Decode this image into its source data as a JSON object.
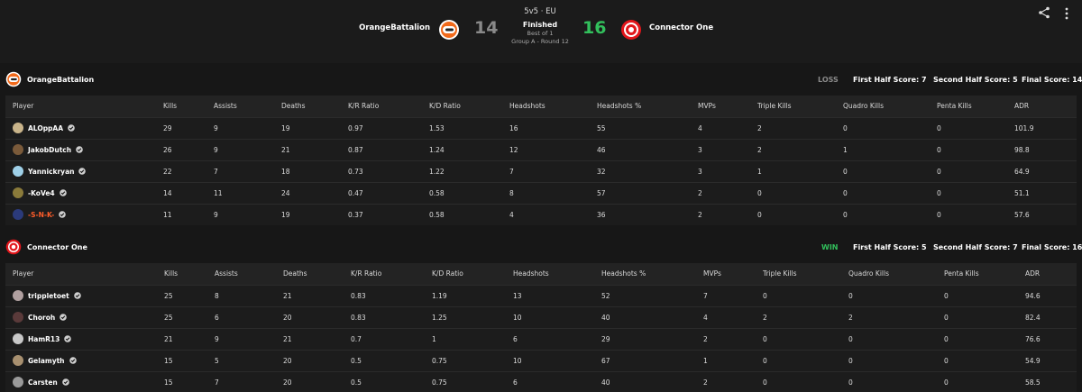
{
  "match": {
    "mode": "5v5 · EU",
    "status": "Finished",
    "best_of": "Best of 1",
    "round": "Group A - Round 12",
    "team1": {
      "name": "OrangeBattalion",
      "score": "14"
    },
    "team2": {
      "name": "Connector One",
      "score": "16"
    }
  },
  "icons": {
    "share": "share-icon",
    "more": "more-vertical-icon",
    "verified": "verified-check-icon"
  },
  "colors": {
    "win": "#32c05c",
    "loss": "#8a8a8a",
    "highlight_name": "#ff5d2a"
  },
  "columns": [
    "Player",
    "Kills",
    "Assists",
    "Deaths",
    "K/R Ratio",
    "K/D Ratio",
    "Headshots",
    "Headshots %",
    "MVPs",
    "Triple Kills",
    "Quadro Kills",
    "Penta Kills",
    "ADR"
  ],
  "teams": [
    {
      "name": "OrangeBattalion",
      "result": "LOSS",
      "first_half": "First Half Score: 7",
      "second_half": "Second Half Score: 5",
      "final": "Final Score: 14",
      "players": [
        {
          "name": "ALOppAA",
          "kills": "29",
          "assists": "9",
          "deaths": "19",
          "kr": "0.97",
          "kd": "1.53",
          "hs": "16",
          "hsp": "55",
          "mvps": "4",
          "triple": "2",
          "quadro": "0",
          "penta": "0",
          "adr": "101.9"
        },
        {
          "name": "JakobDutch",
          "kills": "26",
          "assists": "9",
          "deaths": "21",
          "kr": "0.87",
          "kd": "1.24",
          "hs": "12",
          "hsp": "46",
          "mvps": "3",
          "triple": "2",
          "quadro": "1",
          "penta": "0",
          "adr": "98.8"
        },
        {
          "name": "Yannickryan",
          "kills": "22",
          "assists": "7",
          "deaths": "18",
          "kr": "0.73",
          "kd": "1.22",
          "hs": "7",
          "hsp": "32",
          "mvps": "3",
          "triple": "1",
          "quadro": "0",
          "penta": "0",
          "adr": "64.9"
        },
        {
          "name": "-KoVe4",
          "kills": "14",
          "assists": "11",
          "deaths": "24",
          "kr": "0.47",
          "kd": "0.58",
          "hs": "8",
          "hsp": "57",
          "mvps": "2",
          "triple": "0",
          "quadro": "0",
          "penta": "0",
          "adr": "51.1"
        },
        {
          "name": "-S-N-K-",
          "kills": "11",
          "assists": "9",
          "deaths": "19",
          "kr": "0.37",
          "kd": "0.58",
          "hs": "4",
          "hsp": "36",
          "mvps": "2",
          "triple": "0",
          "quadro": "0",
          "penta": "0",
          "adr": "57.6"
        }
      ]
    },
    {
      "name": "Connector One",
      "result": "WIN",
      "first_half": "First Half Score: 5",
      "second_half": "Second Half Score: 7",
      "final": "Final Score: 16",
      "players": [
        {
          "name": "trippletoet",
          "kills": "25",
          "assists": "8",
          "deaths": "21",
          "kr": "0.83",
          "kd": "1.19",
          "hs": "13",
          "hsp": "52",
          "mvps": "7",
          "triple": "0",
          "quadro": "0",
          "penta": "0",
          "adr": "94.6"
        },
        {
          "name": "Choroh",
          "kills": "25",
          "assists": "6",
          "deaths": "20",
          "kr": "0.83",
          "kd": "1.25",
          "hs": "10",
          "hsp": "40",
          "mvps": "4",
          "triple": "2",
          "quadro": "2",
          "penta": "0",
          "adr": "82.4"
        },
        {
          "name": "HamR13",
          "kills": "21",
          "assists": "9",
          "deaths": "21",
          "kr": "0.7",
          "kd": "1",
          "hs": "6",
          "hsp": "29",
          "mvps": "2",
          "triple": "0",
          "quadro": "0",
          "penta": "0",
          "adr": "76.6"
        },
        {
          "name": "Gelamyth",
          "kills": "15",
          "assists": "5",
          "deaths": "20",
          "kr": "0.5",
          "kd": "0.75",
          "hs": "10",
          "hsp": "67",
          "mvps": "1",
          "triple": "0",
          "quadro": "0",
          "penta": "0",
          "adr": "54.9"
        },
        {
          "name": "Carsten",
          "kills": "15",
          "assists": "7",
          "deaths": "20",
          "kr": "0.5",
          "kd": "0.75",
          "hs": "6",
          "hsp": "40",
          "mvps": "2",
          "triple": "0",
          "quadro": "0",
          "penta": "0",
          "adr": "58.5"
        }
      ]
    }
  ]
}
